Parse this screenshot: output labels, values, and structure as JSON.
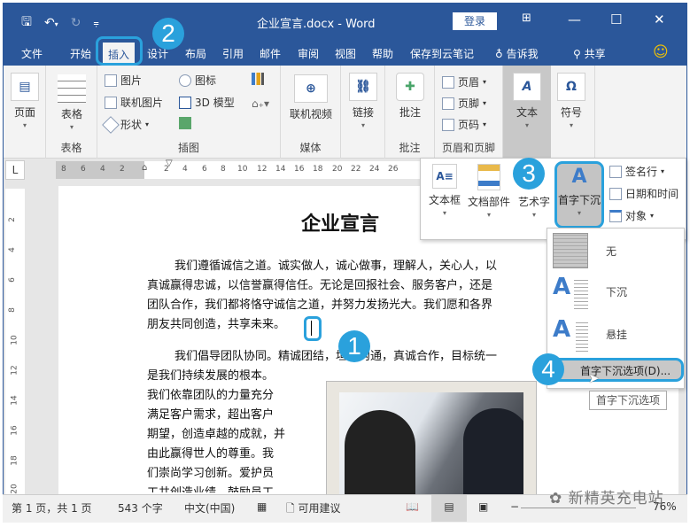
{
  "window": {
    "title": "企业宣言.docx - Word",
    "login_label": "登录",
    "controls": {
      "restore_ribbon": "⊞",
      "minimize": "—",
      "maximize": "☐",
      "close": "✕"
    }
  },
  "qat": {
    "save": "🖫",
    "undo": "↶",
    "undo_caret": "▾",
    "redo": "↻",
    "customize": "⩦"
  },
  "menu": {
    "tabs": [
      "文件",
      "开始",
      "插入",
      "设计",
      "布局",
      "引用",
      "邮件",
      "审阅",
      "视图",
      "帮助",
      "保存到云笔记"
    ],
    "active_tab": "插入",
    "tell_me": "告诉我",
    "share": "共享",
    "feedback_icon": "☺"
  },
  "ribbon": {
    "pages": {
      "label": "页面",
      "group": ""
    },
    "tables": {
      "label": "表格",
      "group": "表格"
    },
    "illustrations": {
      "group": "插图",
      "picture": "图片",
      "online_picture": "联机图片",
      "shapes": "形状",
      "icons": "图标",
      "model3d": "3D 模型"
    },
    "media": {
      "label": "联机视频",
      "group": "媒体"
    },
    "links": {
      "label": "链接"
    },
    "comments": {
      "label": "批注",
      "group": "批注"
    },
    "header_footer": {
      "group": "页眉和页脚",
      "header": "页眉",
      "footer": "页脚",
      "page_number": "页码"
    },
    "text": {
      "label": "文本"
    },
    "symbols": {
      "label": "符号",
      "icon": "Ω"
    }
  },
  "text_panel": {
    "textbox": "文本框",
    "quick_parts": "文档部件",
    "wordart": "艺术字",
    "drop_cap": "首字下沉",
    "signature_line": "签名行",
    "date_time": "日期和时间",
    "object": "对象"
  },
  "drop_cap_menu": {
    "items": [
      "无",
      "下沉",
      "悬挂"
    ],
    "options": "首字下沉选项(D)...",
    "tooltip": "首字下沉选项"
  },
  "ruler": {
    "corner": "L",
    "h_ticks_left": [
      "8",
      "6",
      "4",
      "2"
    ],
    "h_ticks_right": [
      "2",
      "4",
      "6",
      "8",
      "10",
      "12",
      "14",
      "16",
      "18",
      "20",
      "22",
      "24",
      "26"
    ],
    "v_ticks": [
      "2",
      "4",
      "6",
      "8",
      "10",
      "12",
      "14",
      "16",
      "18",
      "20"
    ]
  },
  "document": {
    "title": "企业宣言",
    "para1": [
      "我们遵循诚信之道。诚实做人，诚心做事，理解人，关心人，以",
      "真诚赢得忠诚，以信誉赢得信任。无论是回报社会、服务客户，还是",
      "团队合作，我们都将恪守诚信之道，并努力发扬光大。我们愿和各界",
      "朋友共同创造，共享未来。"
    ],
    "para2_first": "我们倡导团队协同。精诚团结，坦诚沟通，真诚合作，目标统一",
    "para2_lines": [
      "是我们持续发展的根本。",
      "我们依靠团队的力量充分",
      "满足客户需求，超出客户",
      "期望，创造卓越的成就，并",
      "由此赢得世人的尊重。我",
      "们崇尚学习创新。爱护员",
      "工共创造业绩，鼓励员工"
    ]
  },
  "badges": [
    "1",
    "2",
    "3",
    "4"
  ],
  "status": {
    "page": "第 1 页，共 1 页",
    "words": "543 个字",
    "language": "中文(中国)",
    "suggestions": "可用建议",
    "zoom": "76%"
  },
  "watermark": "新精英充电站",
  "colors": {
    "accent": "#2b579a",
    "callout": "#2aa1dc"
  }
}
